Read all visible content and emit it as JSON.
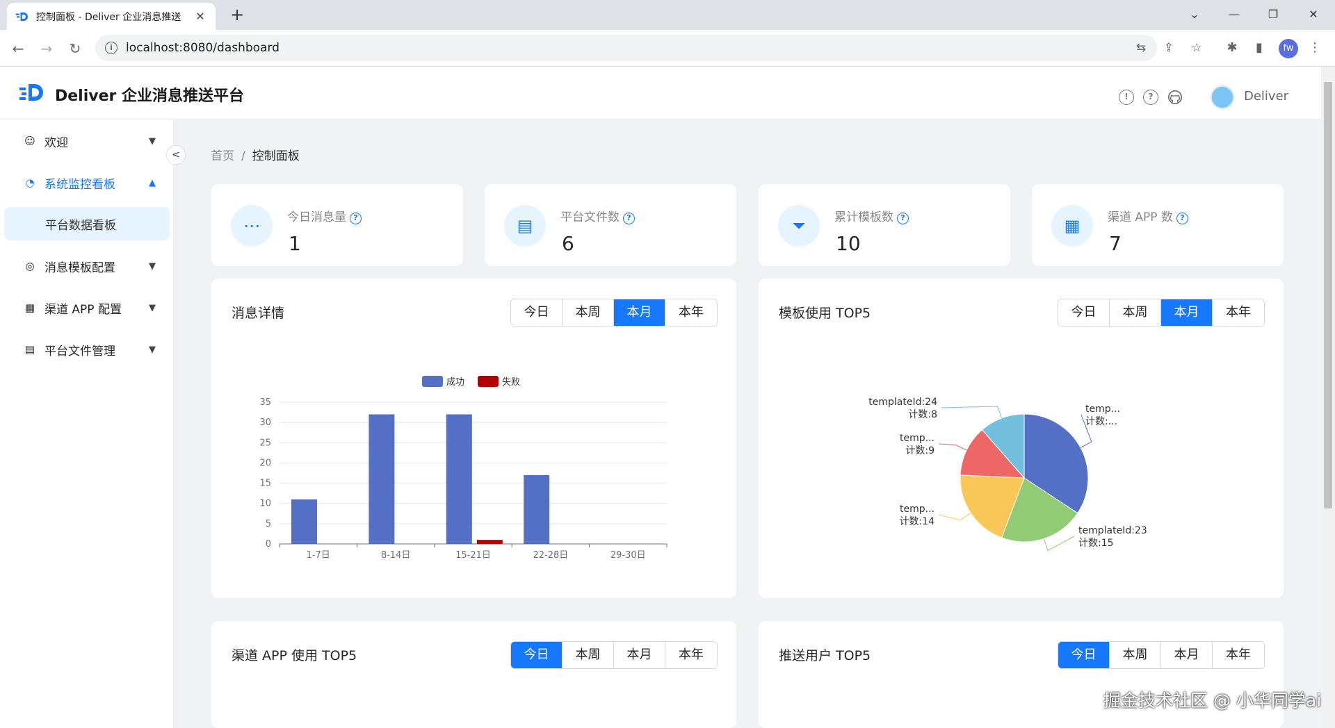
{
  "browser": {
    "tab_title": "控制面板 - Deliver 企业消息推送",
    "url": "localhost:8080/dashboard",
    "profile_initials": "fw"
  },
  "header": {
    "app_title": "Deliver 企业消息推送平台",
    "username": "Deliver",
    "brand_color": "#1677ff"
  },
  "sidebar": {
    "items": [
      {
        "label": "欢迎",
        "icon": "smile-icon"
      },
      {
        "label": "系统监控看板",
        "icon": "dashboard-icon"
      },
      {
        "label": "平台数据看板",
        "icon": ""
      },
      {
        "label": "消息模板配置",
        "icon": "message-icon"
      },
      {
        "label": "渠道 APP 配置",
        "icon": "appstore-icon"
      },
      {
        "label": "平台文件管理",
        "icon": "file-icon"
      }
    ]
  },
  "breadcrumb": {
    "home": "首页",
    "sep": "/",
    "current": "控制面板"
  },
  "stats": [
    {
      "label": "今日消息量",
      "value": "1",
      "icon": "message-icon"
    },
    {
      "label": "平台文件数",
      "value": "6",
      "icon": "file-icon"
    },
    {
      "label": "累计模板数",
      "value": "10",
      "icon": "filter-icon"
    },
    {
      "label": "渠道 APP 数",
      "value": "7",
      "icon": "appstore-icon"
    }
  ],
  "segments": [
    "今日",
    "本周",
    "本月",
    "本年"
  ],
  "panels": {
    "message_detail": {
      "title": "消息详情",
      "selected": "本月"
    },
    "template_top5": {
      "title": "模板使用 TOP5",
      "selected": "本月"
    },
    "channel_top5": {
      "title": "渠道 APP 使用 TOP5",
      "selected": "今日"
    },
    "user_top5": {
      "title": "推送用户 TOP5",
      "selected": "今日"
    }
  },
  "chart_data": [
    {
      "type": "bar",
      "categories": [
        "1-7日",
        "8-14日",
        "15-21日",
        "22-28日",
        "29-30日"
      ],
      "series": [
        {
          "name": "成功",
          "values": [
            11,
            32,
            32,
            17,
            0
          ],
          "color": "#5470c6"
        },
        {
          "name": "失败",
          "values": [
            0,
            0,
            1,
            0,
            0
          ],
          "color": "#b40000"
        }
      ],
      "ylim": [
        0,
        35
      ],
      "yticks": [
        0,
        5,
        10,
        15,
        20,
        25,
        30,
        35
      ],
      "legend": "top-center"
    },
    {
      "type": "pie",
      "slices": [
        {
          "label": "temp...",
          "count_label": "计数:...",
          "value": 24,
          "color": "#5470c6"
        },
        {
          "label": "templateId:23",
          "count_label": "计数:15",
          "value": 15,
          "color": "#91cc75"
        },
        {
          "label": "temp...",
          "count_label": "计数:14",
          "value": 14,
          "color": "#fac858"
        },
        {
          "label": "temp...",
          "count_label": "计数:9",
          "value": 9,
          "color": "#ee6666"
        },
        {
          "label": "templateId:24",
          "count_label": "计数:8",
          "value": 8,
          "color": "#73c0de"
        }
      ]
    }
  ],
  "watermark": "掘金技术社区 @ 小华同学ai"
}
